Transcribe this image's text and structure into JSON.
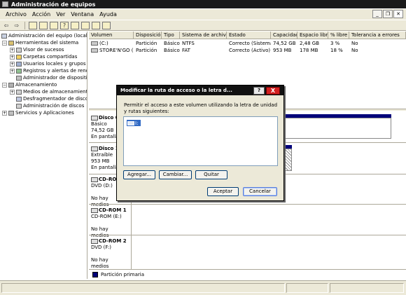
{
  "window": {
    "title": "Administración de equipos"
  },
  "menu": [
    "Archivo",
    "Acción",
    "Ver",
    "Ventana",
    "Ayuda"
  ],
  "tree": {
    "root": "Administración del equipo (local)",
    "items": [
      {
        "label": "Herramientas del sistema",
        "level": 1,
        "expander": "-"
      },
      {
        "label": "Visor de sucesos",
        "level": 2,
        "expander": "+"
      },
      {
        "label": "Carpetas compartidas",
        "level": 2,
        "expander": "+"
      },
      {
        "label": "Usuarios locales y grupos",
        "level": 2,
        "expander": "+"
      },
      {
        "label": "Registros y alertas de rendi",
        "level": 2,
        "expander": "+"
      },
      {
        "label": "Administrador de dispositivos",
        "level": 2,
        "expander": ""
      },
      {
        "label": "Almacenamiento",
        "level": 1,
        "expander": "-"
      },
      {
        "label": "Medios de almacenamiento e",
        "level": 2,
        "expander": "+"
      },
      {
        "label": "Desfragmentador de disco",
        "level": 2,
        "expander": ""
      },
      {
        "label": "Administración de discos",
        "level": 2,
        "expander": ""
      },
      {
        "label": "Servicios y Aplicaciones",
        "level": 1,
        "expander": "+"
      }
    ]
  },
  "volumes": {
    "headers": [
      "Volumen",
      "Disposición",
      "Tipo",
      "Sistema de archivos",
      "Estado",
      "Capacidad",
      "Espacio libre",
      "% libre",
      "Tolerancia a errores"
    ],
    "rows": [
      [
        "(C:)",
        "Partición",
        "Básico",
        "NTFS",
        "Correcto (Sistema)",
        "74,52 GB",
        "2,48 GB",
        "3 %",
        "No"
      ],
      [
        "STORE'N'GO (I:)",
        "Partición",
        "Básico",
        "FAT",
        "Correcto (Activo)",
        "953 MB",
        "178 MB",
        "18 %",
        "No"
      ]
    ]
  },
  "disks": [
    {
      "name": "Disco 0",
      "type": "Básico",
      "size": "74,52 GB",
      "status": "En pantalla"
    },
    {
      "name": "Disco 1",
      "type": "Extraíble",
      "size": "953 MB",
      "status": "En pantalla"
    },
    {
      "name": "CD-ROM 0",
      "type": "DVD (D:)",
      "size": "",
      "status": "No hay medios"
    },
    {
      "name": "CD-ROM 1",
      "type": "CD-ROM (E:)",
      "size": "",
      "status": "No hay medios"
    },
    {
      "name": "CD-ROM 2",
      "type": "DVD (F:)",
      "size": "",
      "status": "No hay medios"
    }
  ],
  "legend": {
    "label": "Partición primaria",
    "color": "#00007a"
  },
  "dialog": {
    "title": "Modificar la ruta de acceso o la letra d...",
    "message": "Permitir el acceso a este volumen utilizando la letra de unidad y rutas siguientes:",
    "item": "I:",
    "add": "Agregar...",
    "change": "Cambiar...",
    "remove": "Quitar",
    "ok": "Aceptar",
    "cancel": "Cancelar",
    "help": "?",
    "close": "X"
  }
}
